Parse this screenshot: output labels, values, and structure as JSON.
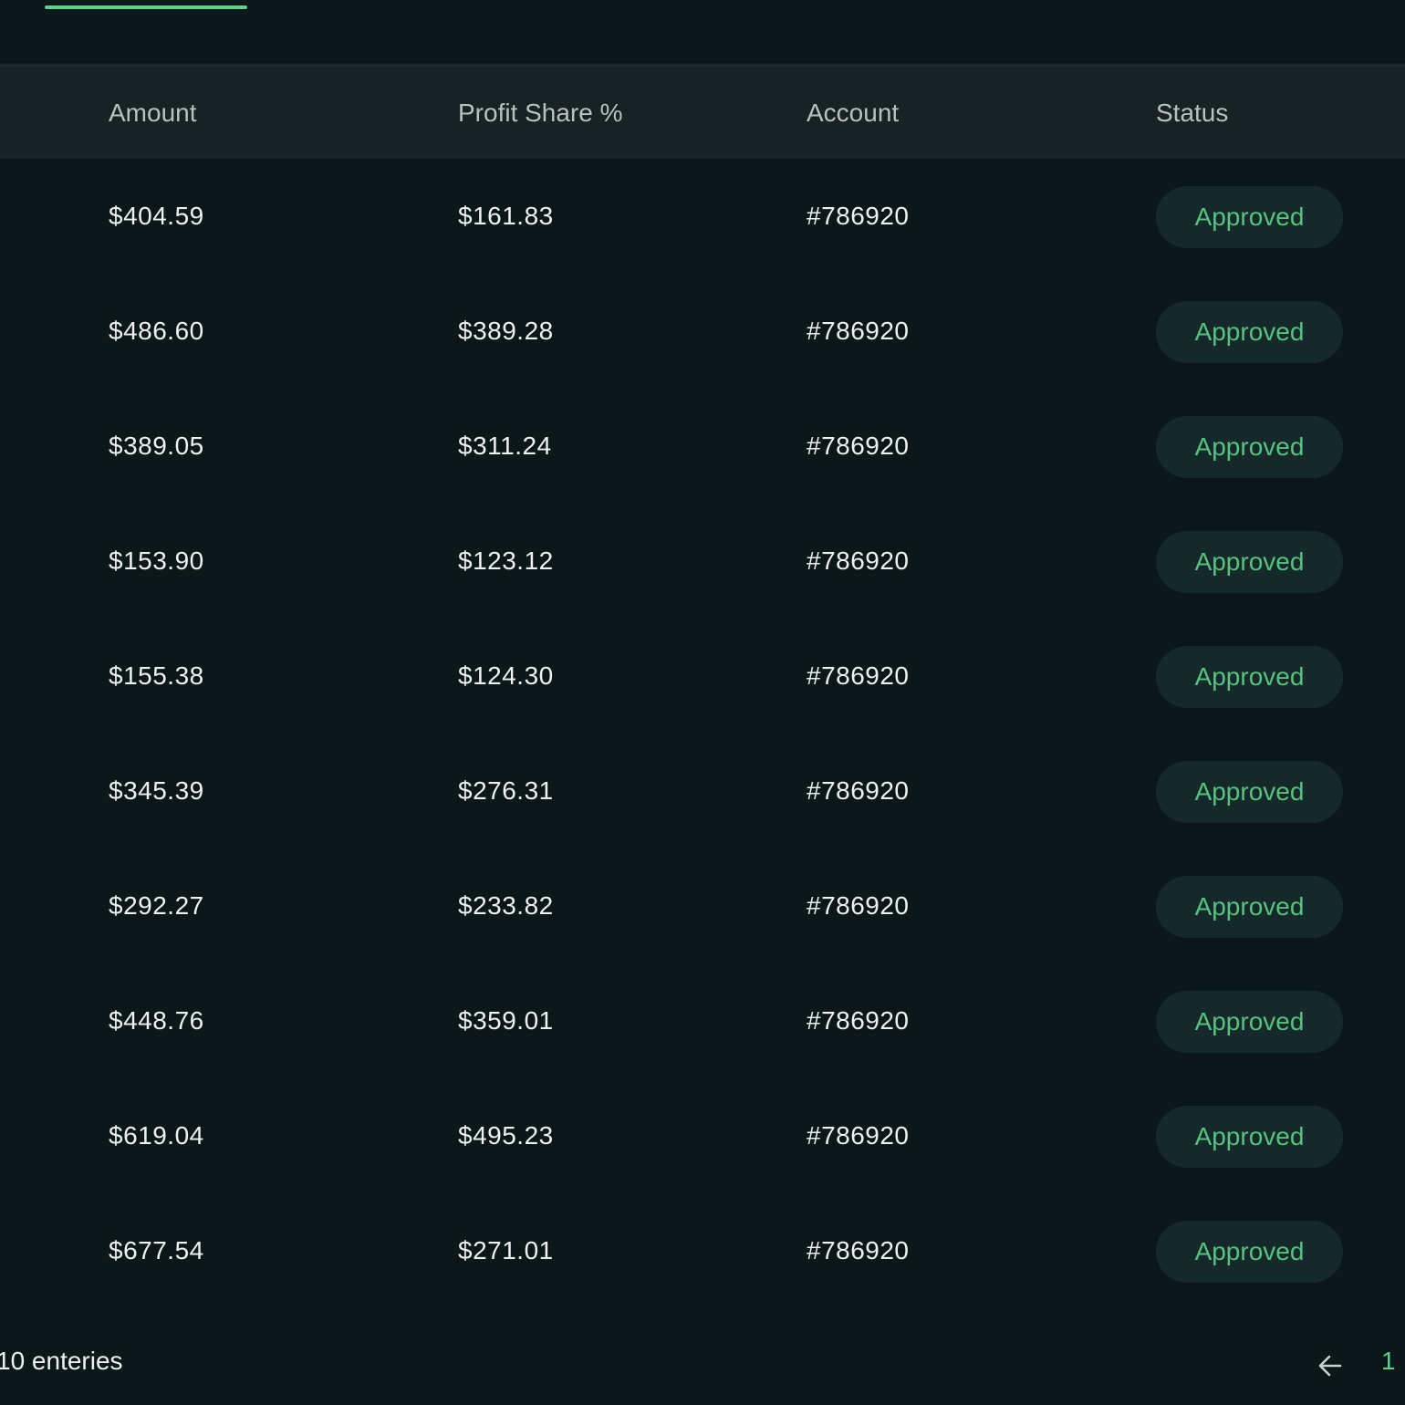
{
  "tabs": {
    "active_indicator_color": "#5fd08a"
  },
  "table": {
    "headers": {
      "amount": "Amount",
      "profit_share": "Profit Share %",
      "account": "Account",
      "status": "Status"
    },
    "rows": [
      {
        "amount": "$404.59",
        "profit_share": "$161.83",
        "account": "#786920",
        "status": "Approved"
      },
      {
        "amount": "$486.60",
        "profit_share": "$389.28",
        "account": "#786920",
        "status": "Approved"
      },
      {
        "amount": "$389.05",
        "profit_share": "$311.24",
        "account": "#786920",
        "status": "Approved"
      },
      {
        "amount": "$153.90",
        "profit_share": "$123.12",
        "account": "#786920",
        "status": "Approved"
      },
      {
        "amount": "$155.38",
        "profit_share": "$124.30",
        "account": "#786920",
        "status": "Approved"
      },
      {
        "amount": "$345.39",
        "profit_share": "$276.31",
        "account": "#786920",
        "status": "Approved"
      },
      {
        "amount": "$292.27",
        "profit_share": "$233.82",
        "account": "#786920",
        "status": "Approved"
      },
      {
        "amount": "$448.76",
        "profit_share": "$359.01",
        "account": "#786920",
        "status": "Approved"
      },
      {
        "amount": "$619.04",
        "profit_share": "$495.23",
        "account": "#786920",
        "status": "Approved"
      },
      {
        "amount": "$677.54",
        "profit_share": "$271.01",
        "account": "#786920",
        "status": "Approved"
      }
    ]
  },
  "footer": {
    "entries_text": "10 enteries",
    "prev_icon": "arrow-left-icon",
    "current_page": "1"
  },
  "colors": {
    "background": "#0b1718",
    "header_background": "#182224",
    "accent": "#5fd08a",
    "status_badge_bg": "#15292a",
    "status_badge_text": "#56c27e"
  }
}
